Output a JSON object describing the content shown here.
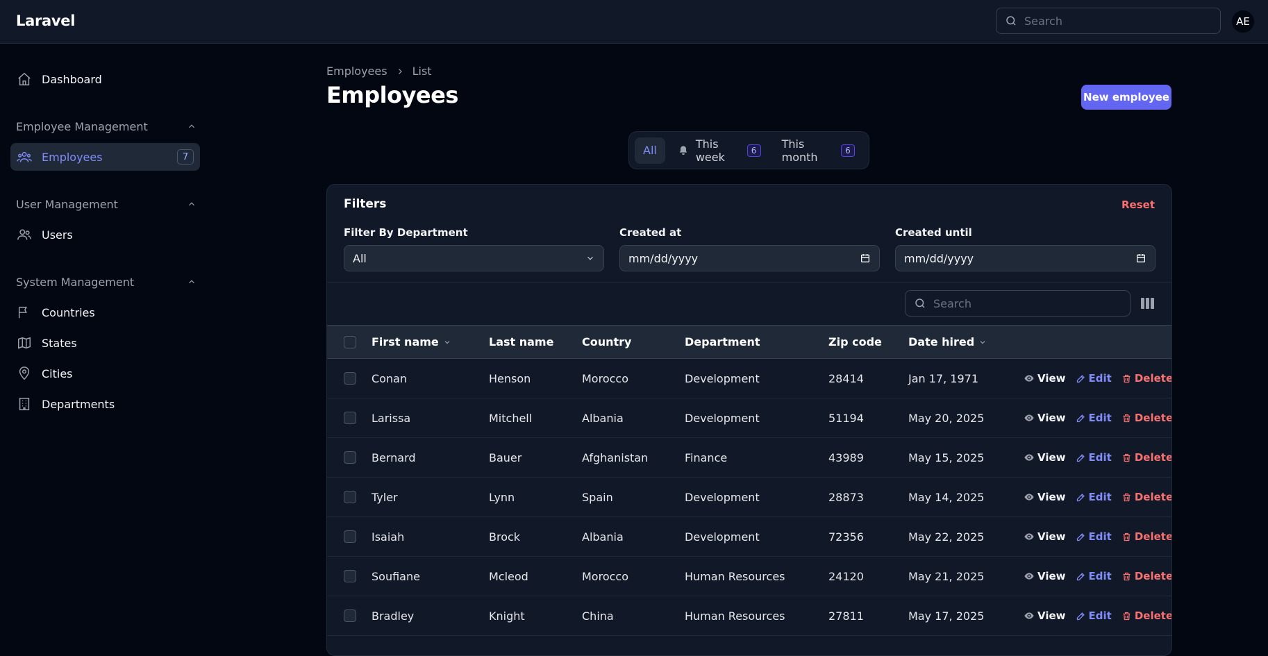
{
  "topbar": {
    "brand": "Laravel",
    "search_placeholder": "Search",
    "avatar_initials": "AE"
  },
  "sidebar": {
    "dashboard": "Dashboard",
    "groups": [
      {
        "label": "Employee Management",
        "items": [
          {
            "label": "Employees",
            "badge": "7",
            "active": true
          }
        ]
      },
      {
        "label": "User Management",
        "items": [
          {
            "label": "Users"
          }
        ]
      },
      {
        "label": "System Management",
        "items": [
          {
            "label": "Countries"
          },
          {
            "label": "States"
          },
          {
            "label": "Cities"
          },
          {
            "label": "Departments"
          }
        ]
      }
    ]
  },
  "breadcrumb": {
    "parent": "Employees",
    "current": "List"
  },
  "page": {
    "title": "Employees",
    "new_button": "New employee"
  },
  "tabs": [
    {
      "label": "All",
      "active": true
    },
    {
      "label": "This week",
      "badge": "6",
      "icon": "bell-icon"
    },
    {
      "label": "This month",
      "badge": "6"
    }
  ],
  "filters": {
    "title": "Filters",
    "reset": "Reset",
    "department_label": "Filter By Department",
    "department_value": "All",
    "created_at_label": "Created at",
    "created_at_value": "mm/dd/yyyy",
    "created_until_label": "Created until",
    "created_until_value": "mm/dd/yyyy"
  },
  "table": {
    "search_placeholder": "Search",
    "columns": {
      "first_name": "First name",
      "last_name": "Last name",
      "country": "Country",
      "department": "Department",
      "zip": "Zip code",
      "hired": "Date hired"
    },
    "actions": {
      "view": "View",
      "edit": "Edit",
      "delete": "Delete"
    },
    "rows": [
      {
        "first": "Conan",
        "last": "Henson",
        "country": "Morocco",
        "department": "Development",
        "zip": "28414",
        "hired": "Jan 17, 1971"
      },
      {
        "first": "Larissa",
        "last": "Mitchell",
        "country": "Albania",
        "department": "Development",
        "zip": "51194",
        "hired": "May 20, 2025"
      },
      {
        "first": "Bernard",
        "last": "Bauer",
        "country": "Afghanistan",
        "department": "Finance",
        "zip": "43989",
        "hired": "May 15, 2025"
      },
      {
        "first": "Tyler",
        "last": "Lynn",
        "country": "Spain",
        "department": "Development",
        "zip": "28873",
        "hired": "May 14, 2025"
      },
      {
        "first": "Isaiah",
        "last": "Brock",
        "country": "Albania",
        "department": "Development",
        "zip": "72356",
        "hired": "May 22, 2025"
      },
      {
        "first": "Soufiane",
        "last": "Mcleod",
        "country": "Morocco",
        "department": "Human Resources",
        "zip": "24120",
        "hired": "May 21, 2025"
      },
      {
        "first": "Bradley",
        "last": "Knight",
        "country": "China",
        "department": "Human Resources",
        "zip": "27811",
        "hired": "May 17, 2025"
      }
    ]
  },
  "colors": {
    "accent": "#6366f1",
    "danger": "#f87171",
    "background": "#030712",
    "surface": "#111827"
  }
}
